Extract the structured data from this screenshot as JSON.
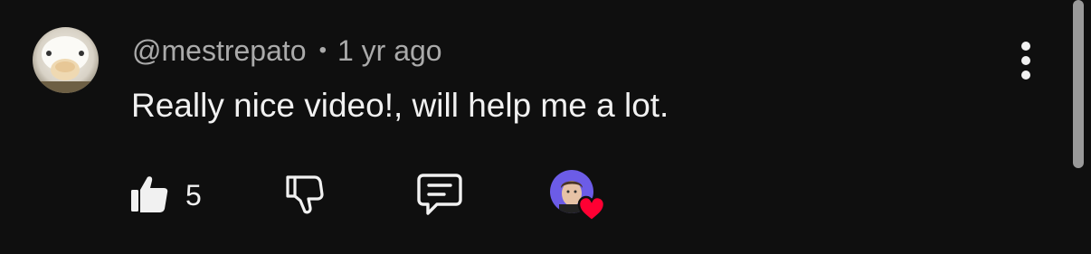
{
  "comment": {
    "author": "@mestrepato",
    "separator": "•",
    "time": "1 yr ago",
    "text": "Really nice video!, will help me a lot.",
    "like_count": "5"
  },
  "icons": {
    "avatar": "user-avatar-duck",
    "menu": "more-vertical-icon",
    "like": "thumbs-up-icon",
    "dislike": "thumbs-down-icon",
    "reply": "comment-reply-icon",
    "creator_heart": "creator-heart-icon"
  },
  "colors": {
    "background": "#0f0f0f",
    "primary_text": "#f1f1f1",
    "secondary_text": "#aaaaaa",
    "heart": "#ff0033",
    "creator_avatar_bg": "#6c5ce7"
  }
}
